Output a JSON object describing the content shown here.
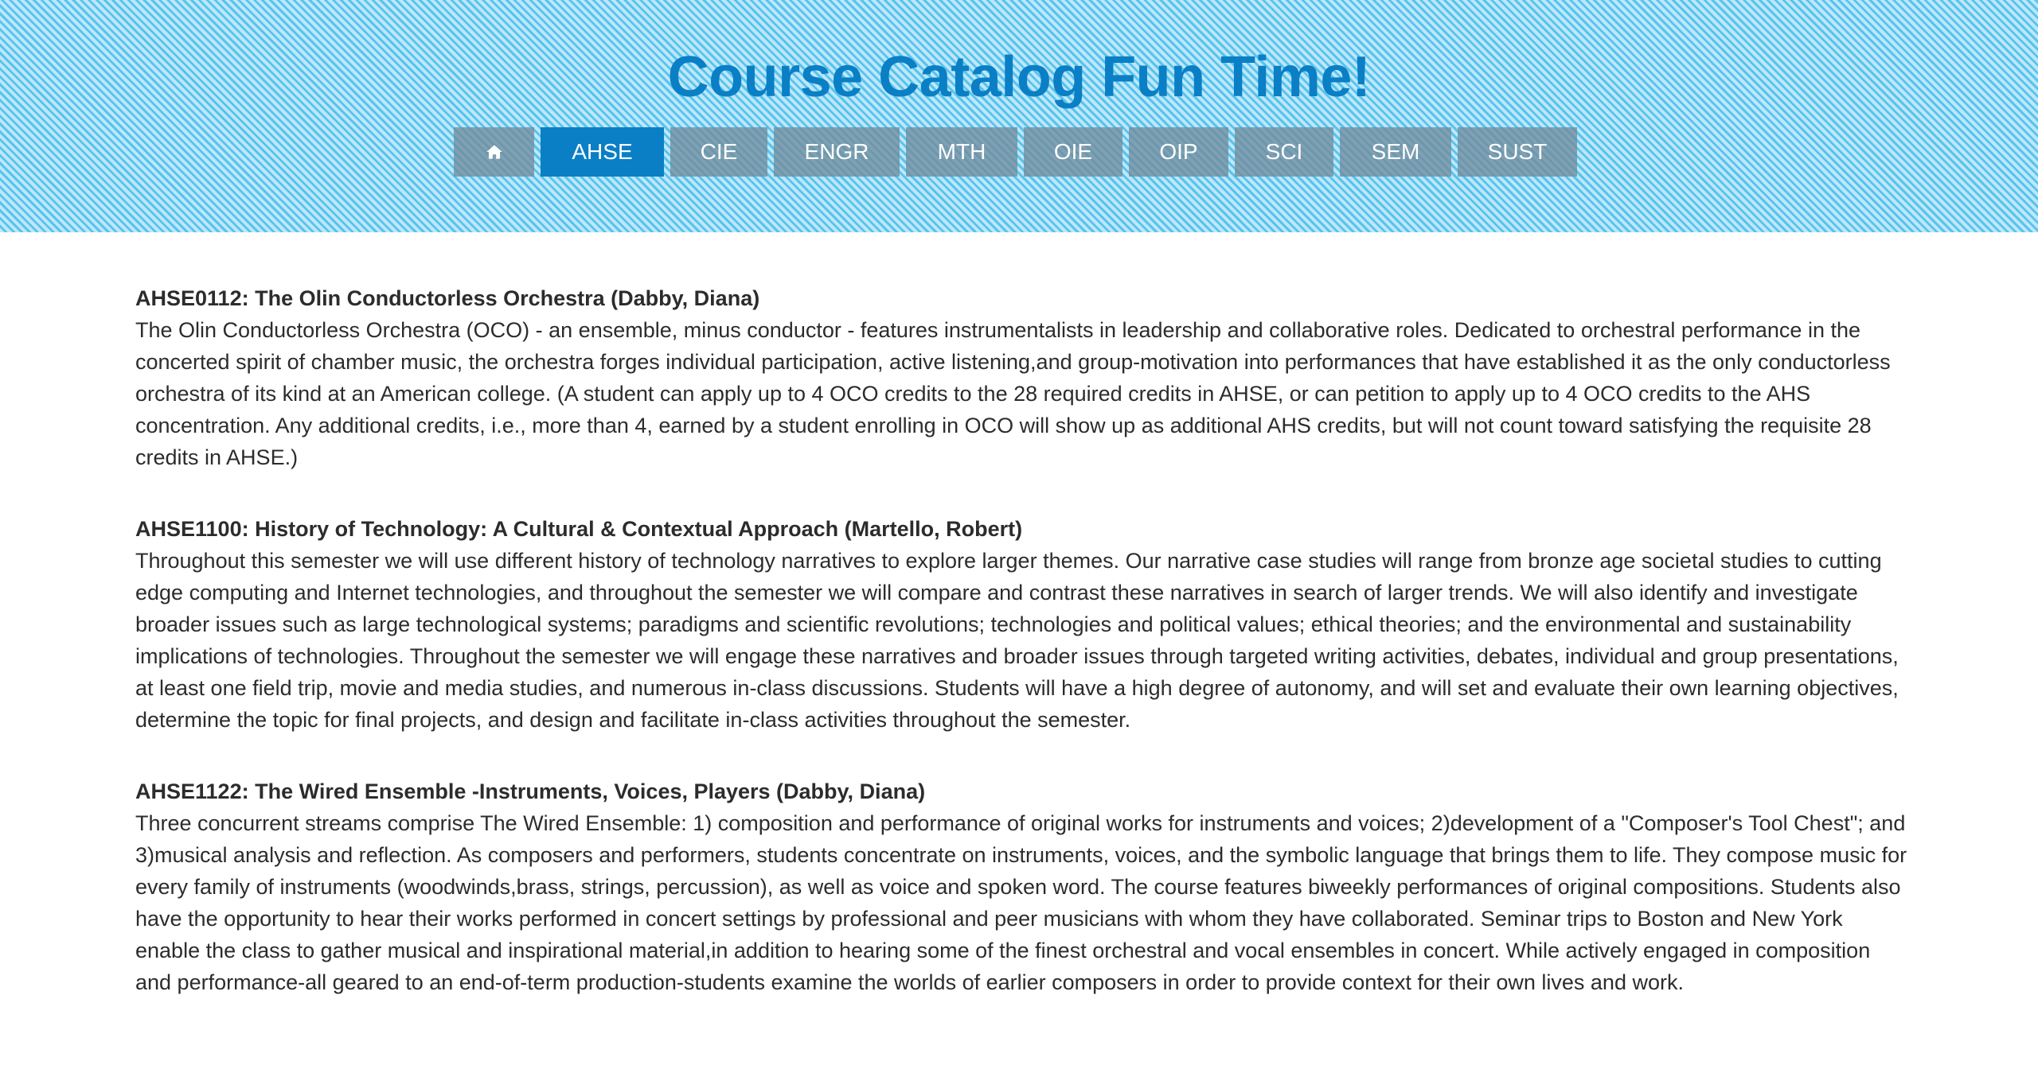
{
  "header": {
    "title": "Course Catalog Fun Time!",
    "home_icon": "home-icon",
    "tabs": [
      {
        "label": "AHSE",
        "active": true
      },
      {
        "label": "CIE",
        "active": false
      },
      {
        "label": "ENGR",
        "active": false
      },
      {
        "label": "MTH",
        "active": false
      },
      {
        "label": "OIE",
        "active": false
      },
      {
        "label": "OIP",
        "active": false
      },
      {
        "label": "SCI",
        "active": false
      },
      {
        "label": "SEM",
        "active": false
      },
      {
        "label": "SUST",
        "active": false
      }
    ]
  },
  "colors": {
    "accent": "#0a7fc5",
    "stripe_light": "#bfe7f9",
    "stripe_dark": "#56c4ee",
    "tab_inactive": "#708c9c",
    "text": "#2c2c2c"
  },
  "courses": [
    {
      "heading": "AHSE0112: The Olin Conductorless Orchestra (Dabby, Diana)",
      "description": "The Olin Conductorless Orchestra (OCO) - an ensemble, minus conductor - features instrumentalists in leadership and collaborative roles. Dedicated to orchestral performance in the concerted spirit of chamber music, the orchestra forges individual participation, active listening,and group-motivation into performances that have established it as the only conductorless orchestra of its kind at an American college. (A student can apply up to 4 OCO credits to the 28 required credits in AHSE, or can petition to apply up to 4 OCO credits to the AHS concentration. Any additional credits, i.e., more than 4, earned by a student enrolling in OCO will show up as additional AHS credits, but will not count toward satisfying the requisite 28 credits in AHSE.)"
    },
    {
      "heading": "AHSE1100: History of Technology: A Cultural & Contextual Approach (Martello, Robert)",
      "description": "Throughout this semester we will use different history of technology narratives to explore larger themes. Our narrative case studies will range from bronze age societal studies to cutting edge computing and Internet technologies, and throughout the semester we will compare and contrast these narratives in search of larger trends. We will also identify and investigate broader issues such as large technological systems; paradigms and scientific revolutions; technologies and political values; ethical theories; and the environmental and sustainability implications of technologies. Throughout the semester we will engage these narratives and broader issues through targeted writing activities, debates, individual and group presentations, at least one field trip, movie and media studies, and numerous in-class discussions. Students will have a high degree of autonomy, and will set and evaluate their own learning objectives, determine the topic for final projects, and design and facilitate in-class activities throughout the semester."
    },
    {
      "heading": "AHSE1122: The Wired Ensemble -Instruments, Voices, Players (Dabby, Diana)",
      "description": "Three concurrent streams comprise The Wired Ensemble: 1) composition and performance of original works for instruments and voices; 2)development of a \"Composer's Tool Chest\"; and 3)musical analysis and reflection. As composers and performers, students concentrate on instruments, voices, and the symbolic language that brings them to life. They compose music for every family of instruments (woodwinds,brass, strings, percussion), as well as voice and spoken word. The course features biweekly performances of original compositions. Students also have the opportunity to hear their works performed in concert settings by professional and peer musicians with whom they have collaborated. Seminar trips to Boston and New York enable the class to gather musical and inspirational material,in addition to hearing some of the finest orchestral and vocal ensembles in concert. While actively engaged in composition and performance-all geared to an end-of-term production-students examine the worlds of earlier composers in order to provide context for their own lives and work."
    }
  ]
}
